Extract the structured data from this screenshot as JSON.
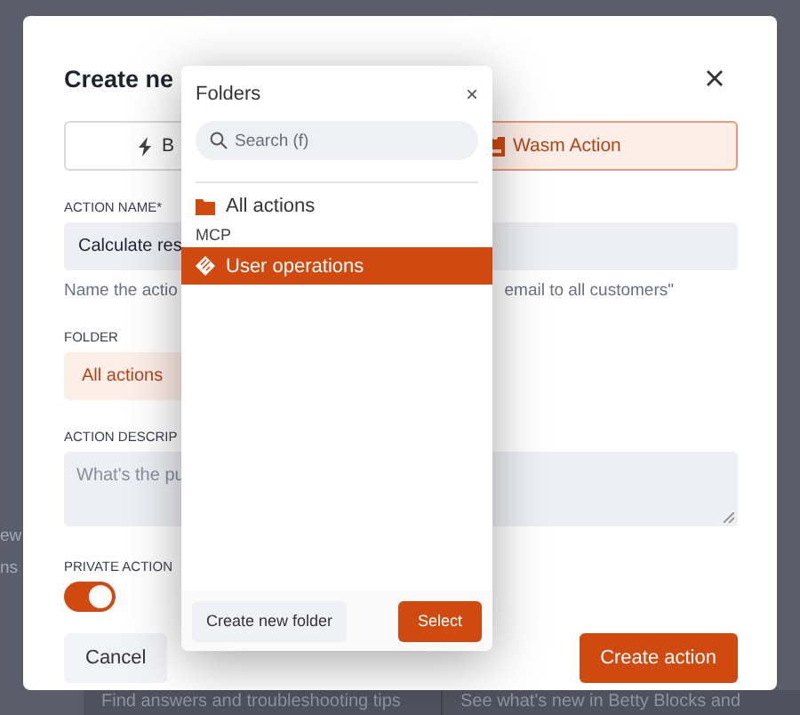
{
  "background": {
    "side_fragments": [
      "ew",
      "ns"
    ],
    "footer_texts": [
      "Find answers and troubleshooting tips",
      "See what's new in Betty Blocks and"
    ]
  },
  "dialog": {
    "title": "Create ne",
    "tabs": [
      {
        "label": "B",
        "kind": "lightning",
        "selected": false
      },
      {
        "label": "Wasm Action",
        "kind": "wasm",
        "selected": true
      }
    ],
    "name_field": {
      "label": "ACTION NAME*",
      "value": "Calculate res",
      "help_left": "Name the actio",
      "help_right": "email to all customers\""
    },
    "folder_field": {
      "label": "FOLDER",
      "value": "All actions"
    },
    "description_field": {
      "label": "ACTION DESCRIP",
      "placeholder": "What's the pu"
    },
    "private_toggle": {
      "label": "PRIVATE ACTION",
      "on": true
    },
    "buttons": [
      {
        "label": "Cancel",
        "kind": "secondary"
      },
      {
        "label": "Create action",
        "kind": "primary"
      }
    ]
  },
  "folder_picker": {
    "title": "Folders",
    "close": "×",
    "search": {
      "placeholder": "Search (f)"
    },
    "items": [
      {
        "label": "All actions",
        "kind": "folder",
        "selected": false
      },
      {
        "label": "MCP",
        "kind": "heading",
        "selected": false
      },
      {
        "label": "User operations",
        "kind": "mcp",
        "selected": true
      }
    ],
    "buttons": [
      {
        "label": "Create new folder",
        "kind": "secondary"
      },
      {
        "label": "Select",
        "kind": "primary"
      }
    ]
  }
}
